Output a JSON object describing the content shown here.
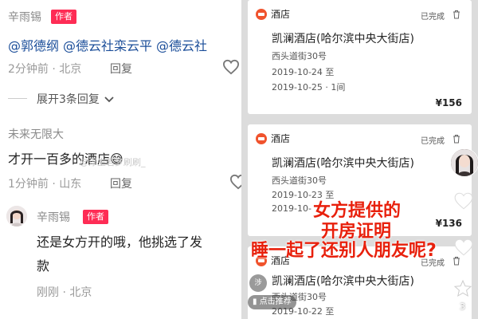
{
  "comments": {
    "first": {
      "username": "辛雨锡",
      "badge": "作者",
      "mentions": [
        "@郭德纲",
        "@德云社栾云平",
        "@德云社"
      ],
      "time": "2分钟前",
      "location": "北京",
      "reply": "回复"
    },
    "expand": "展开3条回复",
    "second": {
      "username": "未来无限大",
      "text": "才开一百多的酒店",
      "emoji": "😅",
      "watermark": "@浮生若梦刷刷_",
      "time": "1分钟前",
      "location": "山东",
      "reply": "回复"
    },
    "third": {
      "username": "辛雨锡",
      "badge": "作者",
      "line1": "还是女方开的哦，他挑选了发",
      "line2": "款",
      "time": "刚刚",
      "location": "北京"
    }
  },
  "orders": [
    {
      "tag": "酒店",
      "status": "已完成",
      "hotel": "凯澜酒店(哈尔滨中央大街店)",
      "address": "西头道街30号",
      "checkin": "2019-10-24 至",
      "checkout": "2019-10-25 · 1间",
      "price": "¥156"
    },
    {
      "tag": "酒店",
      "status": "已完成",
      "hotel": "凯澜酒店(哈尔滨中央大街店)",
      "address": "西头道街30号",
      "checkin": "2019-10-23 至",
      "checkout": "2019-10-",
      "price": "¥136"
    },
    {
      "tag": "酒店",
      "status": "已完成",
      "hotel": "凯澜酒店(哈尔滨中央大街店)",
      "address": "西头道街30号",
      "checkin": "2019-10-22 至"
    }
  ],
  "overlay": {
    "line1": "女方提供的",
    "line2": "开房证明",
    "line3": "睡一起了还别人朋友呢?"
  },
  "sidebar": {
    "count_small": "3",
    "bottom_avatar_text": "涉",
    "recommend": "点击推荐"
  },
  "colors": {
    "accent": "#fe2c55",
    "mention": "#1a4d99",
    "overlay_red": "#e8200c",
    "hotel_icon": "#f0532d"
  },
  "icons": [
    "heart-icon",
    "chevron-down-icon",
    "hotel-icon",
    "trash-icon",
    "star-icon"
  ]
}
